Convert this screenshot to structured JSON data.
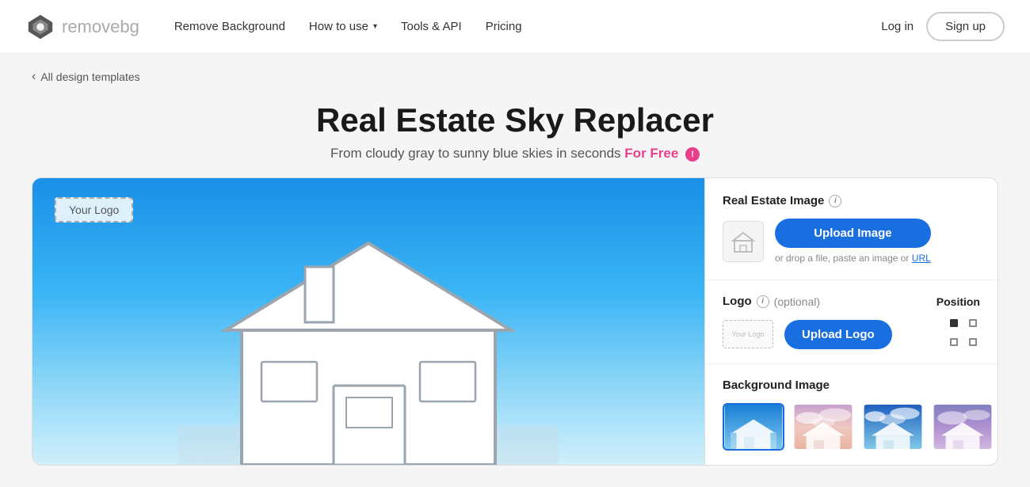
{
  "nav": {
    "logo_text_bold": "remove",
    "logo_text_light": "bg",
    "links": [
      {
        "id": "remove-background",
        "label": "Remove Background",
        "has_dropdown": false
      },
      {
        "id": "how-to-use",
        "label": "How to use",
        "has_dropdown": true
      },
      {
        "id": "tools-api",
        "label": "Tools & API",
        "has_dropdown": false
      },
      {
        "id": "pricing",
        "label": "Pricing",
        "has_dropdown": false
      }
    ],
    "login_label": "Log in",
    "signup_label": "Sign up"
  },
  "breadcrumb": {
    "label": "All design templates",
    "icon": "‹"
  },
  "page": {
    "title": "Real Estate Sky Replacer",
    "subtitle": "From cloudy gray to sunny blue skies in seconds",
    "for_free_label": "For Free",
    "info_symbol": "!"
  },
  "right_panel": {
    "real_estate_section": {
      "title": "Real Estate Image",
      "upload_button": "Upload Image",
      "drop_hint": "or drop a file, paste an image or",
      "url_link": "URL"
    },
    "logo_section": {
      "title": "Logo",
      "optional": "(optional)",
      "position_label": "Position",
      "upload_logo_button": "Upload Logo",
      "logo_placeholder": "Your Logo"
    },
    "background_section": {
      "title": "Background Image",
      "thumbnails": [
        {
          "id": "bg1",
          "selected": true,
          "sky": "clear_blue"
        },
        {
          "id": "bg2",
          "selected": false,
          "sky": "cloudy_pink"
        },
        {
          "id": "bg3",
          "selected": false,
          "sky": "blue_clouds"
        },
        {
          "id": "bg4",
          "selected": false,
          "sky": "purple_dusk"
        }
      ]
    }
  },
  "preview": {
    "logo_placeholder": "Your Logo"
  }
}
